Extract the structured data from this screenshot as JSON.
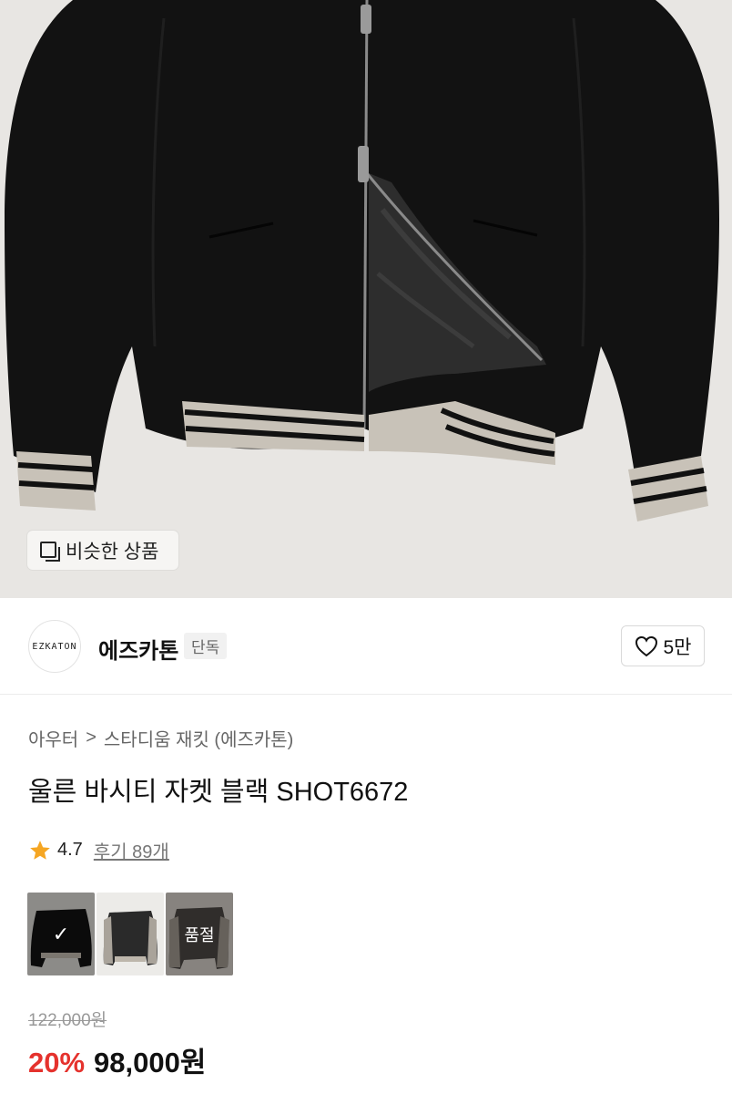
{
  "hero": {
    "similar_label": "비슷한 상품"
  },
  "brand": {
    "logo_text": "EZKATON",
    "name": "에즈카톤",
    "badge": "단독",
    "like_count": "5만"
  },
  "breadcrumb": {
    "items": [
      "아우터",
      "스타디움 재킷 (에즈카톤)"
    ],
    "separator": ">"
  },
  "product": {
    "title": "울른 바시티 자켓 블랙 SHOT6672",
    "rating": "4.7",
    "reviews": "후기 89개",
    "swatches": [
      {
        "selected": true,
        "label": "",
        "color": "#111111"
      },
      {
        "selected": false,
        "label": "",
        "color": "#2a2a2a"
      },
      {
        "selected": false,
        "label": "품절",
        "color": "#4a4542"
      }
    ],
    "original_price": "122,000원",
    "discount": "20%",
    "price": "98,000원"
  },
  "colors": {
    "accent_red": "#e5322d",
    "star": "#f5a623",
    "jacket": "#111111",
    "rib": "#c8c2b8"
  },
  "icons": [
    "similar-products-icon",
    "heart-icon",
    "star-icon",
    "check-icon",
    "chevron-right-icon"
  ]
}
